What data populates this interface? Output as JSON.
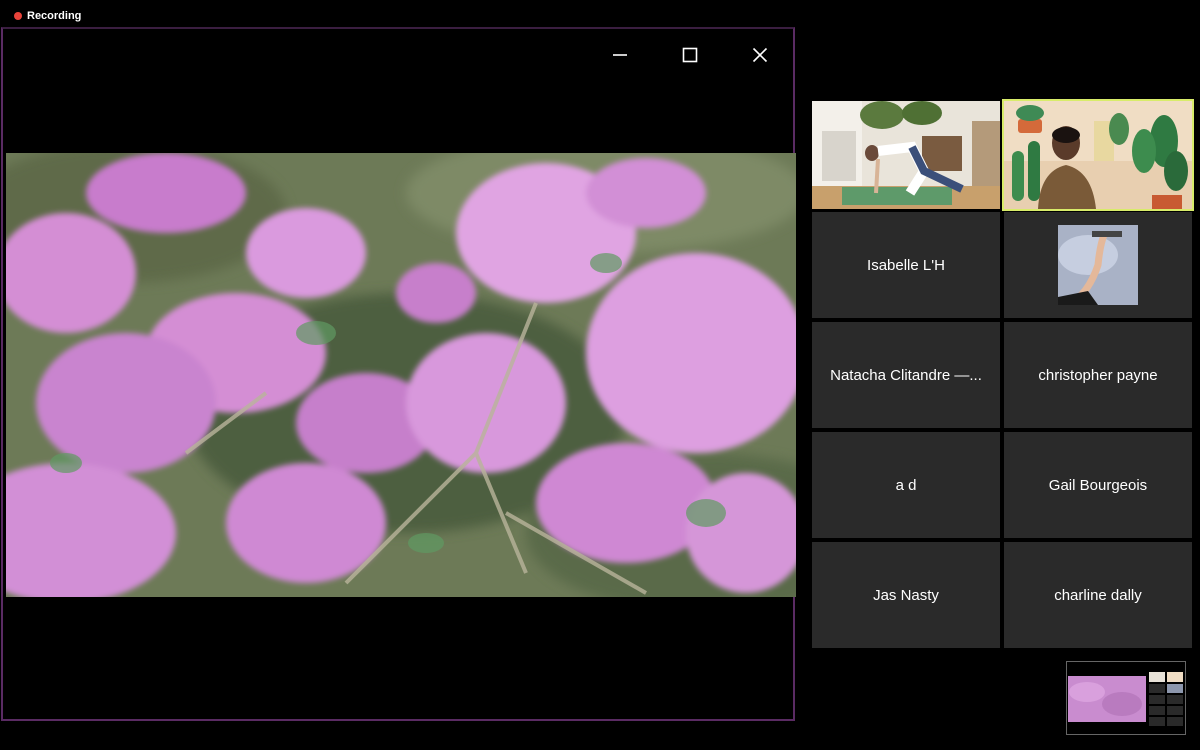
{
  "recording": {
    "label": "Recording",
    "dot_color": "#e8433a"
  },
  "share_window": {
    "controls": {
      "minimize_icon": "minimize-icon",
      "maximize_icon": "maximize-icon",
      "close_icon": "close-icon"
    },
    "content": "pink-azalea-flowers-video",
    "border_color": "#5a2b63"
  },
  "participants": {
    "video_tiles": [
      {
        "id": "yoga-participant",
        "active": false
      },
      {
        "id": "speaker-plant-background",
        "active": true
      }
    ],
    "name_tiles": [
      {
        "name": "Isabelle L'H"
      },
      {
        "name": "",
        "has_thumbnail": true
      },
      {
        "name": "Natacha Clitandre —..."
      },
      {
        "name": "christopher payne"
      },
      {
        "name": "a d"
      },
      {
        "name": "Gail Bourgeois"
      },
      {
        "name": "Jas Nasty"
      },
      {
        "name": "charline dally"
      }
    ],
    "active_speaker_color": "#d8ec6a"
  }
}
